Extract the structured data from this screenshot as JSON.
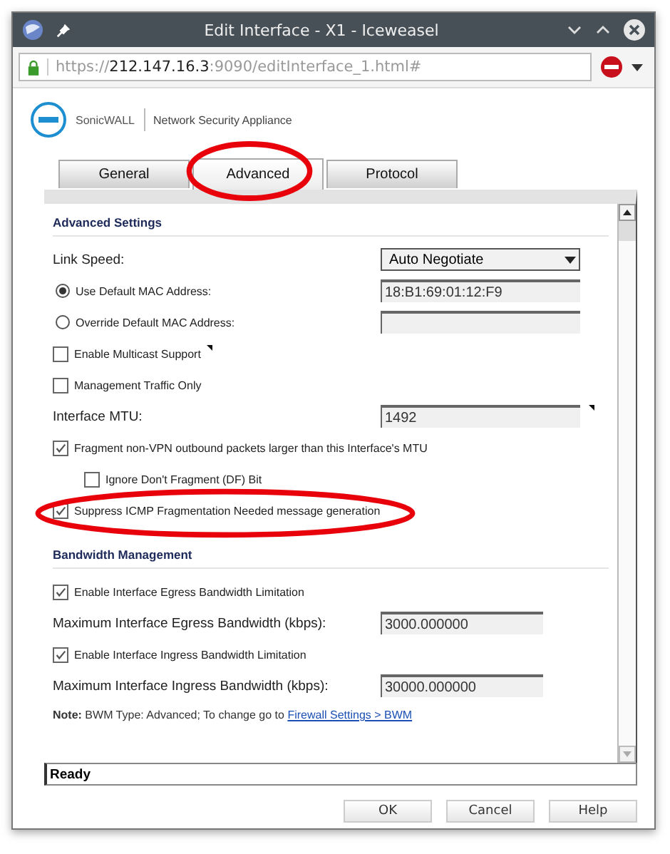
{
  "window": {
    "title": "Edit Interface - X1 - Iceweasel"
  },
  "address_bar": {
    "scheme": "https://",
    "host": "212.147.16.3",
    "rest": ":9090/editInterface_1.html#"
  },
  "header": {
    "brand": "SonicWALL",
    "product": "Network Security Appliance"
  },
  "tabs": [
    {
      "label": "General",
      "selected": false,
      "circled": false
    },
    {
      "label": "Advanced",
      "selected": true,
      "circled": true
    },
    {
      "label": "Protocol",
      "selected": false,
      "circled": false
    }
  ],
  "sections": [
    {
      "title": "Advanced Settings",
      "rows": [
        {
          "kind": "select",
          "label": "Link Speed:",
          "value": "Auto Negotiate"
        },
        {
          "kind": "radio",
          "label": "Use Default MAC Address:",
          "selected": true,
          "value": "18:B1:69:01:12:F9"
        },
        {
          "kind": "radio",
          "label": "Override Default MAC Address:",
          "selected": false
        },
        {
          "kind": "checkbox",
          "label": "Enable Multicast Support",
          "checked": false,
          "info_mark": true
        },
        {
          "kind": "checkbox",
          "label": "Management Traffic Only",
          "checked": false
        },
        {
          "kind": "field",
          "label": "Interface MTU:",
          "value": "1492",
          "info_mark": true
        },
        {
          "kind": "checkbox",
          "label": "Fragment non-VPN outbound packets larger than this Interface's MTU",
          "checked": true,
          "children": [
            {
              "kind": "checkbox",
              "label": "Ignore Don't Fragment (DF) Bit",
              "checked": false
            }
          ]
        },
        {
          "kind": "checkbox",
          "label": "Suppress ICMP Fragmentation Needed message generation",
          "checked": true,
          "circled": true
        }
      ]
    },
    {
      "title": "Bandwidth Management",
      "rows": [
        {
          "kind": "checkbox",
          "label": "Enable Interface Egress Bandwidth Limitation",
          "checked": true
        },
        {
          "kind": "field",
          "label": "Maximum Interface Egress Bandwidth (kbps):",
          "value": "3000.000000"
        },
        {
          "kind": "checkbox",
          "label": "Enable Interface Ingress Bandwidth Limitation",
          "checked": true
        },
        {
          "kind": "field",
          "label": "Maximum Interface Ingress Bandwidth (kbps):",
          "value": "30000.000000"
        }
      ]
    }
  ],
  "note": {
    "text": "**Note:** BWM Type: Advanced; To change go to",
    "link": "Firewall Settings > BWM"
  },
  "status_bar": "Ready",
  "buttons": [
    "OK",
    "Cancel",
    "Help"
  ]
}
